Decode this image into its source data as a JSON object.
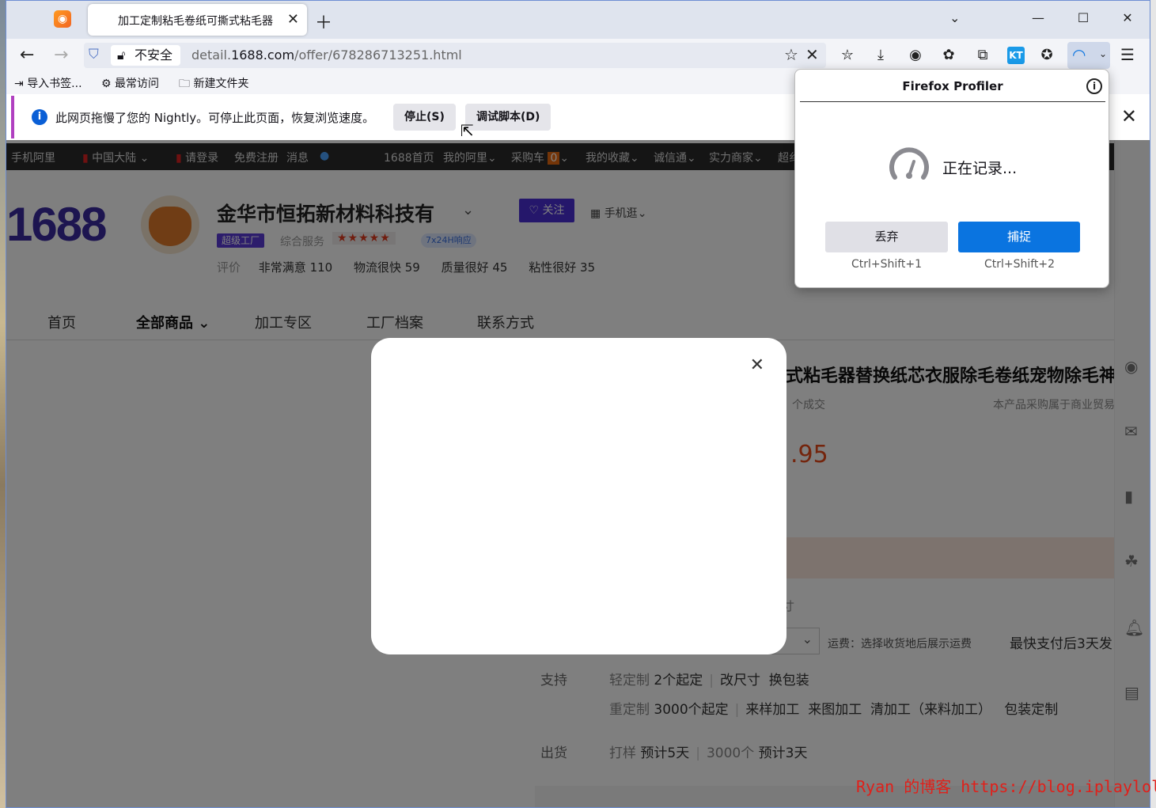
{
  "tab": {
    "title": "加工定制粘毛卷纸可撕式粘毛器"
  },
  "nav": {
    "insecure_label": "不安全",
    "url_prefix": "detail.",
    "url_domain": "1688.com",
    "url_path": "/offer/678286713251.html"
  },
  "bookmarks": {
    "import": "导入书签...",
    "most_visited": "最常访问",
    "new_folder": "新建文件夹"
  },
  "notification": {
    "text": "此网页拖慢了您的 Nightly。可停止此页面，恢复浏览速度。",
    "stop_label": "停止(S)",
    "debug_label": "调试脚本(D)"
  },
  "profiler": {
    "title": "Firefox Profiler",
    "status": "正在记录...",
    "discard_label": "丢弃",
    "capture_label": "捕捉",
    "discard_shortcut": "Ctrl+Shift+1",
    "capture_shortcut": "Ctrl+Shift+2"
  },
  "site_topbar": {
    "mobile": "手机阿里",
    "region": "中国大陆",
    "login": "请登录",
    "register": "免费注册",
    "messages": "消息",
    "home": "1688首页",
    "my_ali": "我的阿里",
    "cart": "采购车",
    "cart_count": "0",
    "favorites": "我的收藏",
    "chengxin": "诚信通",
    "merchants": "实力商家",
    "more": "超纟"
  },
  "shop": {
    "logo": "1688",
    "name": "金华市恒拓新材料科技有",
    "follow": "关注",
    "mobile_shop": "手机逛",
    "factory_badge": "超级工厂",
    "service_label": "综合服务",
    "stars": "★★★★★",
    "response_badge": "7x24H响应",
    "reviews_label": "评价",
    "reviews": [
      "非常满意 110",
      "物流很快 59",
      "质量很好 45",
      "粘性很好 35"
    ]
  },
  "shop_nav": [
    "首页",
    "全部商品",
    "加工专区",
    "工厂档案",
    "联系方式"
  ],
  "product": {
    "title": "式粘毛器替换纸芯衣服除毛卷纸宠物除毛神",
    "sub": "个成交",
    "note": "本产品采购属于商业贸易",
    "price": ".95",
    "hint": "寸",
    "shipping": "运费：选择收货地后展示运费",
    "ship_time": "最快支付后3天发",
    "support_label": "支持",
    "light_label": "轻定制",
    "light_min": "2个起定",
    "light_items": [
      "改尺寸",
      "换包装"
    ],
    "heavy_label": "重定制",
    "heavy_min": "3000个起定",
    "heavy_items": [
      "来样加工",
      "来图加工",
      "清加工（来料加工）",
      "包装定制"
    ],
    "ship_label": "出货",
    "sample_label": "打样",
    "sample_days": "预计5天",
    "bulk_label": "3000个",
    "bulk_days": "预计3天"
  },
  "watermark": "Ryan 的博客 https://blog.iplayloli.com"
}
